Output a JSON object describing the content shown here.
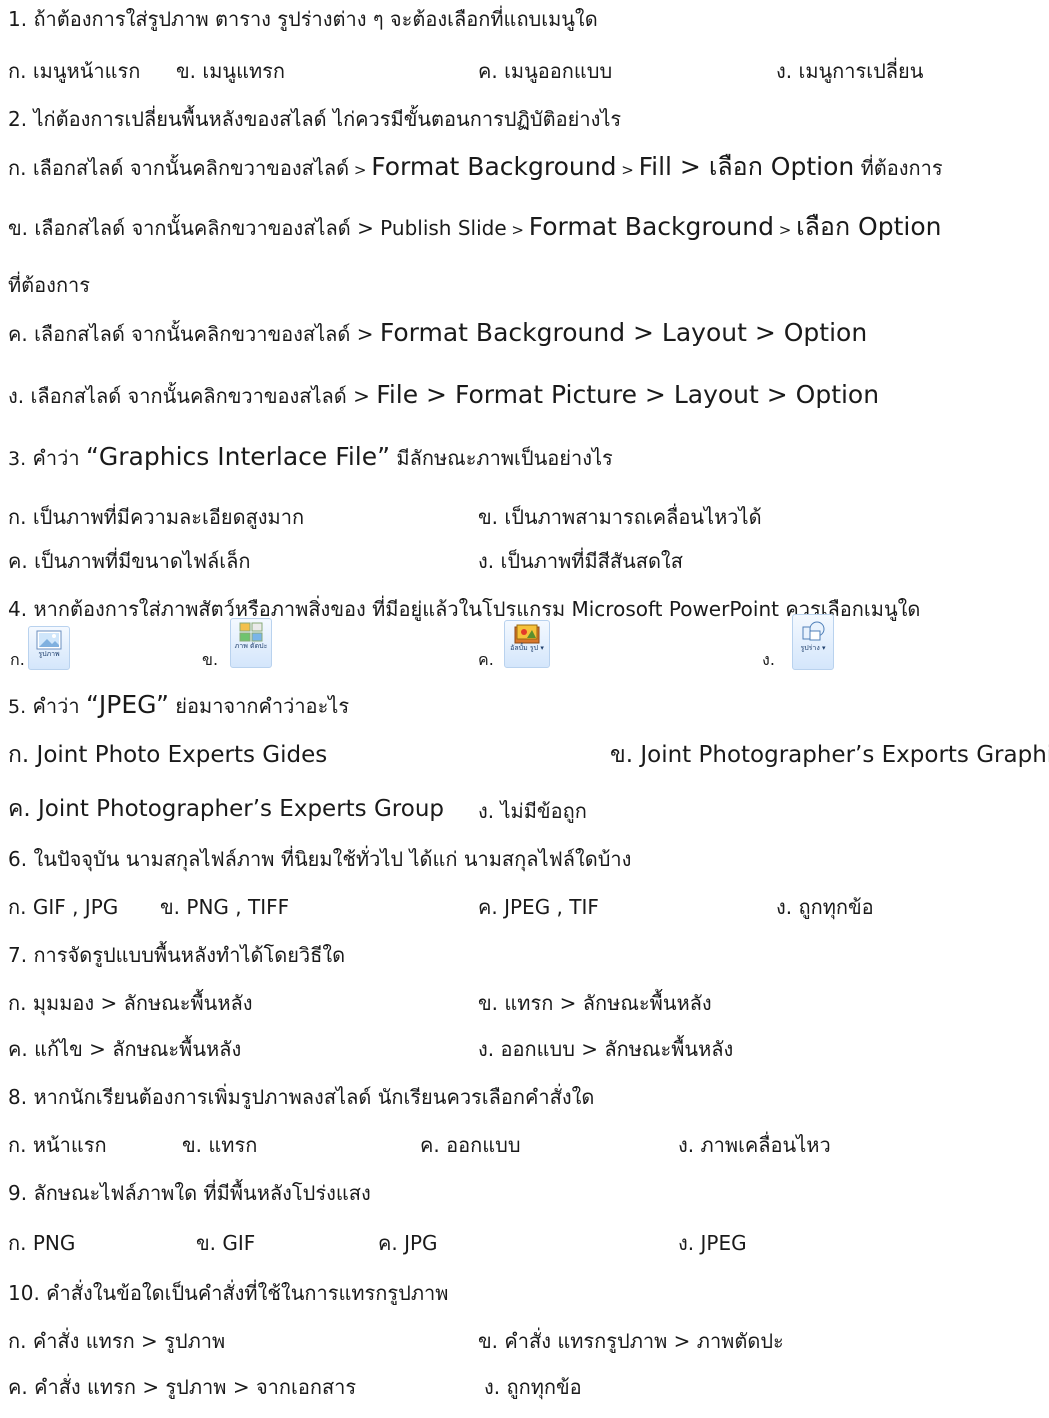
{
  "q1": {
    "question": "1. ถ้าต้องการใส่รูปภาพ  ตาราง  รูปร่างต่าง ๆ จะต้องเลือกที่แถบเมนูใด",
    "a": "ก. เมนูหน้าแรก",
    "b": "ข. เมนูแทรก",
    "c": "ค. เมนูออกแบบ",
    "d": "ง. เมนูการเปลี่ยน"
  },
  "q2": {
    "question": "2. ไก่ต้องการเปลี่ยนพื้นหลังของสไลด์ ไก่ควรมีขั้นตอนการปฏิบัติอย่างไร",
    "a_1": "ก. เลือกสไลด์ จากนั้นคลิกขวาของสไลด์",
    "a_2": " > ",
    "a_3": "Format Background",
    "a_4": " > ",
    "a_5": "Fill > เลือก Option",
    "a_6": " ที่ต้องการ",
    "b_1": "ข. เลือกสไลด์ จากนั้นคลิกขวาของสไลด์ > Publish Slide",
    "b_2": " > ",
    "b_3": "Format Background",
    "b_4": " > ",
    "b_5": "เลือก Option",
    "b_cont": "ที่ต้องการ",
    "c_1": "ค. เลือกสไลด์ จากนั้นคลิกขวาของสไลด์ > ",
    "c_2": "Format Background > Layout > Option",
    "d_1": "ง. เลือกสไลด์ จากนั้นคลิกขวาของสไลด์ > ",
    "d_2": "File > Format Picture > Layout > Option"
  },
  "q3": {
    "q_num": "3.",
    "q_1": " คำว่า ",
    "q_2": "“Graphics Interlace File”",
    "q_3": " มีลักษณะภาพเป็นอย่างไร",
    "a": "ก. เป็นภาพที่มีความละเอียดสูงมาก",
    "b": "ข. เป็นภาพสามารถเคลื่อนไหวได้",
    "c": "ค. เป็นภาพที่มีขนาดไฟล์เล็ก",
    "d": "ง. เป็นภาพที่มีสีสันสดใส"
  },
  "q4": {
    "question": "4. หากต้องการใส่ภาพสัตว์หรือภาพสิ่งของ ที่มีอยู่แล้วในโปรแกรม Microsoft PowerPoint ควรเลือกเมนูใด",
    "a": "ก.",
    "b": "ข.",
    "c": "ค.",
    "d": "ง.",
    "icon_a": "รูปภาพ",
    "icon_b": "ภาพ ตัดปะ",
    "icon_c": "อัลบั้ม รูป ▾",
    "icon_d": "รูปร่าง ▾"
  },
  "q5": {
    "q_num": "5.",
    "q_1": " คำว่า ",
    "q_2": "“JPEG”",
    "q_3": " ย่อมาจากคำว่าอะไร",
    "a": "ก. Joint Photo Experts Gides",
    "b": "ข. Joint Photographer’s Exports Graphics",
    "c": "ค. Joint Photographer’s Experts Group",
    "d": "ง. ไม่มีข้อถูก"
  },
  "q6": {
    "question": "6. ในปัจจุบัน นามสกุลไฟล์ภาพ ที่นิยมใช้ทั่วไป ได้แก่ นามสกุลไฟล์ใดบ้าง",
    "a": "ก. GIF , JPG",
    "b": "ข. PNG , TIFF",
    "c": "ค. JPEG , TIF",
    "d": "ง. ถูกทุกข้อ"
  },
  "q7": {
    "question": "7. การจัดรูปแบบพื้นหลังทำได้โดยวิธีใด",
    "a": "ก. มุมมอง > ลักษณะพื้นหลัง",
    "b": "ข. แทรก > ลักษณะพื้นหลัง",
    "c": "ค. แก้ไข > ลักษณะพื้นหลัง",
    "d": "ง. ออกแบบ > ลักษณะพื้นหลัง"
  },
  "q8": {
    "question": "8. หากนักเรียนต้องการเพิ่มรูปภาพลงสไลด์ นักเรียนควรเลือกคำสั่งใด",
    "a": "ก. หน้าแรก",
    "b": "ข. แทรก",
    "c": "ค. ออกแบบ",
    "d": "ง. ภาพเคลื่อนไหว"
  },
  "q9": {
    "question": "9. ลักษณะไฟล์ภาพใด ที่มีพื้นหลังโปร่งแสง",
    "a": "ก. PNG",
    "b": "ข. GIF",
    "c": "ค. JPG",
    "d": "ง. JPEG"
  },
  "q10": {
    "question": "10. คำสั่งในข้อใดเป็นคำสั่งที่ใช้ในการแทรกรูปภาพ",
    "a": "ก. คำสั่ง แทรก > รูปภาพ",
    "b": "ข. คำสั่ง แทรกรูปภาพ > ภาพตัดปะ",
    "c": "ค. คำสั่ง แทรก > รูปภาพ > จากเอกสาร",
    "d": "ง. ถูกทุกข้อ"
  }
}
